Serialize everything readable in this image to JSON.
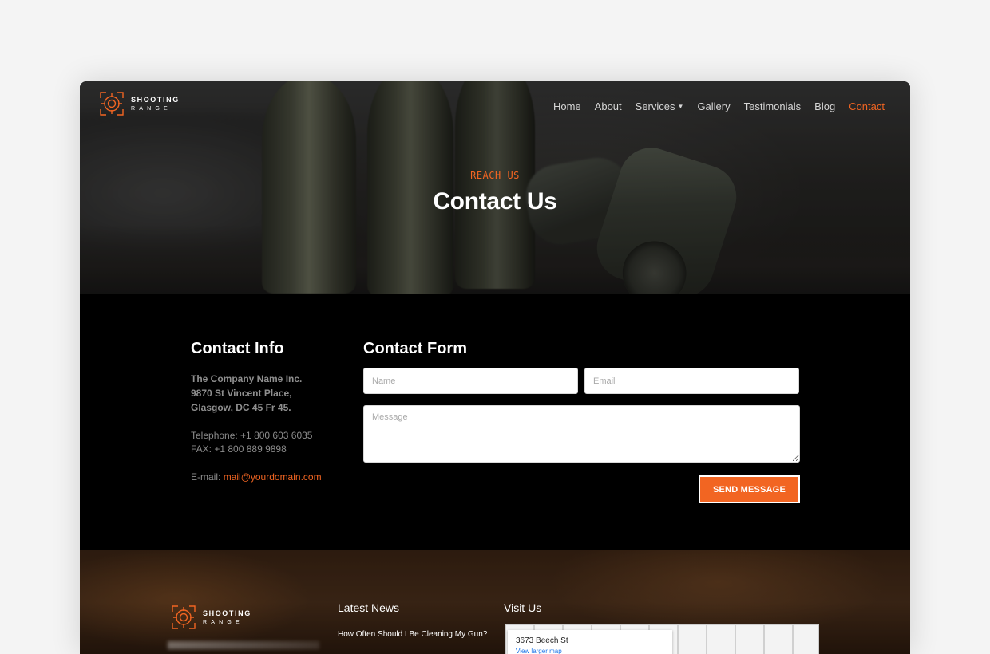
{
  "brand": {
    "name_top": "SHOOTING",
    "name_bottom": "RANGE",
    "accent": "#f26522"
  },
  "nav": {
    "items": [
      {
        "label": "Home"
      },
      {
        "label": "About"
      },
      {
        "label": "Services"
      },
      {
        "label": "Gallery"
      },
      {
        "label": "Testimonials"
      },
      {
        "label": "Blog"
      },
      {
        "label": "Contact"
      }
    ],
    "active": "Contact"
  },
  "hero": {
    "eyebrow": "REACH US",
    "title": "Contact Us"
  },
  "contact_info": {
    "title": "Contact Info",
    "address": [
      "The Company Name Inc.",
      "9870 St Vincent Place,",
      "Glasgow, DC 45 Fr 45."
    ],
    "telephone": "Telephone: +1 800 603 6035",
    "fax": "FAX: +1 800 889 9898",
    "email_label": "E-mail:",
    "email": "mail@yourdomain.com"
  },
  "contact_form": {
    "title": "Contact Form",
    "name_placeholder": "Name",
    "email_placeholder": "Email",
    "message_placeholder": "Message",
    "submit_label": "SEND MESSAGE"
  },
  "footer": {
    "latest_news_title": "Latest News",
    "news_items": [
      "How Often Should I Be Cleaning My Gun?"
    ],
    "visit_title": "Visit Us",
    "map_address": "3673 Beech St",
    "map_link": "View larger map"
  }
}
